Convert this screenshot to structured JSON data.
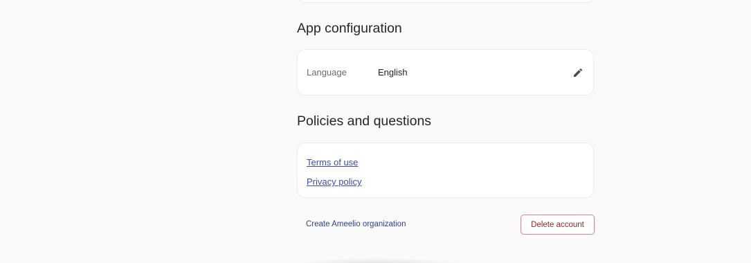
{
  "sections": {
    "app_configuration": {
      "title": "App configuration",
      "language_label": "Language",
      "language_value": "English",
      "edit_icon": "pencil-icon"
    },
    "policies": {
      "title": "Policies and questions",
      "terms_link": "Terms of use",
      "privacy_link": "Privacy policy"
    }
  },
  "footer": {
    "create_org_label": "Create Ameelio organization",
    "delete_account_label": "Delete account"
  },
  "colors": {
    "link": "#3a4ea8",
    "danger": "#8a2a2a",
    "background": "#fafafa"
  }
}
